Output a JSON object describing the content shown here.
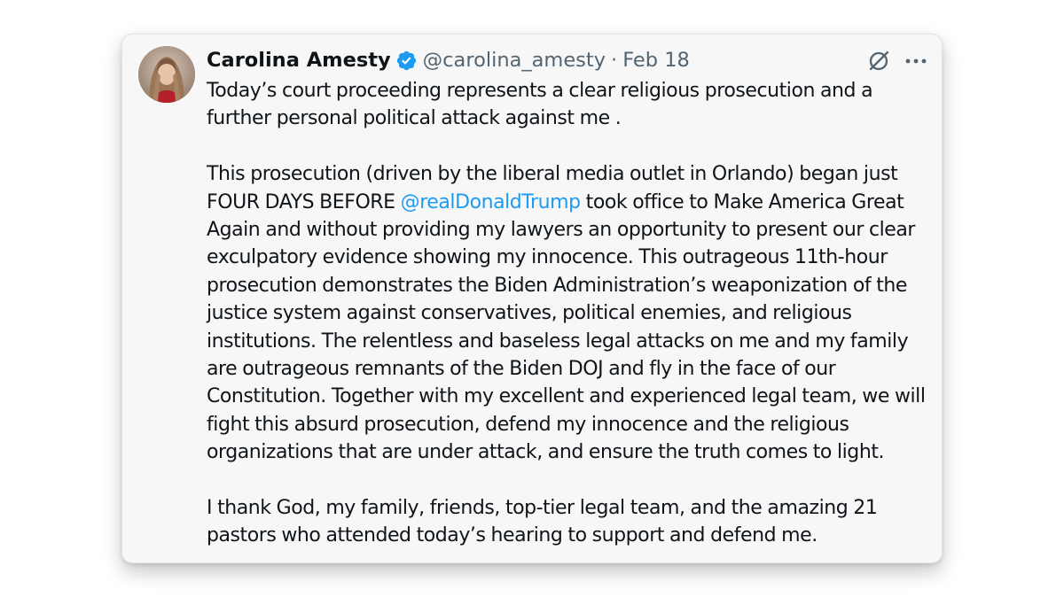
{
  "tweet": {
    "author": {
      "display_name": "Carolina Amesty",
      "handle": "@carolina_amesty",
      "verified": true,
      "verified_badge_color": "#1d9bf0",
      "avatar_icon": "profile-photo"
    },
    "separator": "·",
    "date": "Feb 18",
    "actions": {
      "grok_icon": "grok-slash-circle-icon",
      "more_icon": "more-horizontal-icon"
    },
    "body": {
      "paragraph_1": "Today’s court proceeding represents a clear religious prosecution and a further personal political attack against me .",
      "paragraph_2_before_mention": "This prosecution (driven by the liberal media outlet in Orlando) began just FOUR DAYS BEFORE ",
      "paragraph_2_mention": "@realDonaldTrump",
      "paragraph_2_after_mention": " took office to Make America Great Again and without providing my lawyers an opportunity to present our clear exculpatory evidence showing my innocence. This outrageous 11th-hour prosecution demonstrates the Biden Administration’s weaponization of the justice system against conservatives, political enemies, and religious institutions. The relentless and baseless legal attacks on me and my family are outrageous remnants of the Biden DOJ and fly in the face of our Constitution.  Together with my excellent and experienced legal team, we will fight this absurd prosecution, defend my innocence and the religious organizations that are under attack, and ensure the truth comes to light.",
      "paragraph_3": "I thank God, my family, friends, top-tier legal team, and the amazing 21 pastors who attended today’s hearing to support and defend me."
    },
    "colors": {
      "text": "#0f1419",
      "secondary_text": "#536471",
      "link": "#1d9bf0",
      "card_background": "#f7f7f8"
    }
  }
}
